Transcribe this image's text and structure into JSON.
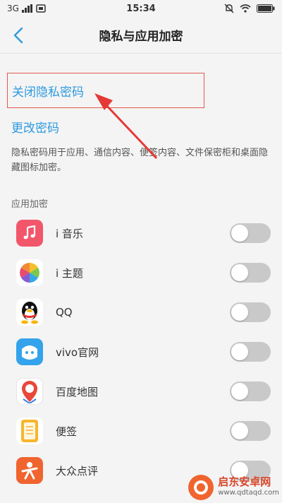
{
  "status_bar": {
    "network": "3G",
    "time": "15:34"
  },
  "nav": {
    "title": "隐私与应用加密"
  },
  "actions": {
    "close_password": "关闭隐私密码",
    "change_password": "更改密码"
  },
  "description": "隐私密码用于应用、通信内容、便签内容、文件保密柜和桌面隐藏图标加密。",
  "section_label": "应用加密",
  "apps": [
    {
      "name": "i 音乐",
      "icon": "music-icon",
      "color": "#f2566a",
      "enabled": false
    },
    {
      "name": "i 主题",
      "icon": "theme-pinwheel-icon",
      "color": "#ffffff",
      "enabled": false
    },
    {
      "name": "QQ",
      "icon": "qq-penguin-icon",
      "color": "#ffffff",
      "enabled": false
    },
    {
      "name": "vivo官网",
      "icon": "vivo-store-icon",
      "color": "#34a3ec",
      "enabled": false
    },
    {
      "name": "百度地图",
      "icon": "map-pin-icon",
      "color": "#ffffff",
      "enabled": false
    },
    {
      "name": "便签",
      "icon": "notepad-icon",
      "color": "#f8b52c",
      "enabled": false
    },
    {
      "name": "大众点评",
      "icon": "dianping-icon",
      "color": "#f0642f",
      "enabled": false
    }
  ],
  "watermark": {
    "name": "启东安卓网",
    "url": "www.qdtaqd.com"
  },
  "colors": {
    "link": "#2d9ae0",
    "highlight_box": "#e25a4d",
    "toggle_off": "#c9c9c9"
  }
}
